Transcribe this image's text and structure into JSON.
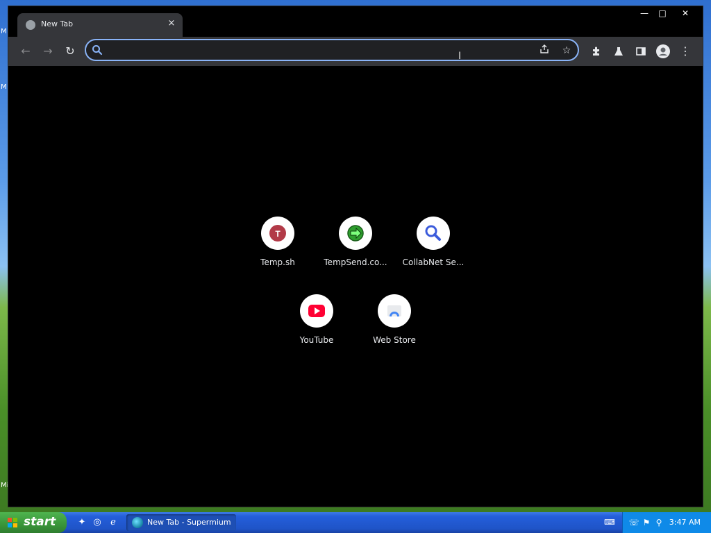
{
  "desktop": {
    "label_fragments": [
      "M",
      "M",
      "Mi"
    ]
  },
  "tab": {
    "title": "New Tab",
    "close": "×"
  },
  "window_controls": {
    "minimize": "—",
    "maximize": "□",
    "close": "✕"
  },
  "toolbar": {
    "back": "←",
    "forward": "→",
    "reload": "↻",
    "omnibox_value": "",
    "omnibox_placeholder": ""
  },
  "shortcuts": [
    {
      "title": "Temp.sh",
      "icon": "temp-sh-icon",
      "letter": "T",
      "color": "#b23a48"
    },
    {
      "title": "TempSend.co...",
      "icon": "tempsend-icon",
      "color": "#2e9e2e"
    },
    {
      "title": "CollabNet Se...",
      "icon": "collabnet-search-icon",
      "color": "#3b5bdb"
    },
    {
      "title": "YouTube",
      "icon": "youtube-icon",
      "color": "#ff0033"
    },
    {
      "title": "Web Store",
      "icon": "web-store-icon",
      "color": "#4285f4"
    }
  ],
  "taskbar": {
    "start_label": "start",
    "task_label": "New Tab - Supermium",
    "clock": "3:47 AM"
  }
}
